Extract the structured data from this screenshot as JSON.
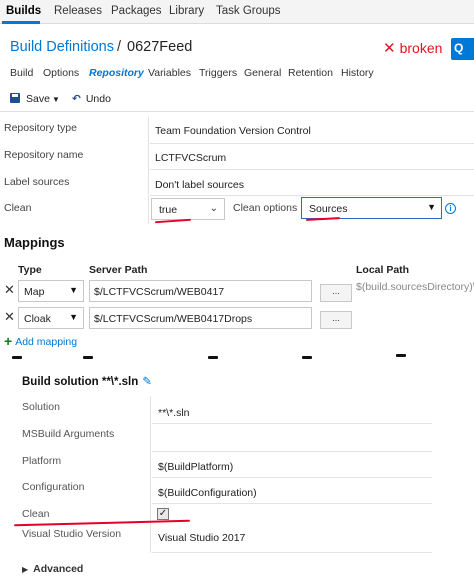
{
  "topnav": {
    "items": [
      "Builds",
      "Releases",
      "Packages",
      "Library",
      "Task Groups"
    ],
    "active": "Builds"
  },
  "header": {
    "breadcrumb": "Build Definitions",
    "separator": "/",
    "definition_name": "0627Feed",
    "status": "broken",
    "queue_button_text": "Q"
  },
  "tabs": {
    "items": [
      "Build",
      "Options",
      "Repository",
      "Variables",
      "Triggers",
      "General",
      "Retention",
      "History"
    ],
    "active": "Repository"
  },
  "toolbar": {
    "save_label": "Save",
    "undo_label": "Undo"
  },
  "repository": {
    "type_label": "Repository type",
    "type_value": "Team Foundation Version Control",
    "name_label": "Repository name",
    "name_value": "LCTFVCScrum",
    "label_sources_label": "Label sources",
    "label_sources_value": "Don't label sources",
    "clean_label": "Clean",
    "clean_value": "true",
    "clean_options_label": "Clean options",
    "clean_options_value": "Sources"
  },
  "mappings": {
    "title": "Mappings",
    "headers": {
      "type": "Type",
      "server_path": "Server Path",
      "local_path": "Local Path"
    },
    "rows": [
      {
        "type": "Map",
        "server_path": "$/LCTFVCScrum/WEB0417",
        "local_path": "$(build.sourcesDirectory)\\"
      },
      {
        "type": "Cloak",
        "server_path": "$/LCTFVCScrum/WEB0417Drops",
        "local_path": ""
      }
    ],
    "browse_label": "...",
    "add_label": "Add mapping"
  },
  "task": {
    "title": "Build solution **\\*.sln",
    "fields": {
      "solution_label": "Solution",
      "solution_value": "**\\*.sln",
      "msbuild_label": "MSBuild Arguments",
      "msbuild_value": "",
      "platform_label": "Platform",
      "platform_value": "$(BuildPlatform)",
      "configuration_label": "Configuration",
      "configuration_value": "$(BuildConfiguration)",
      "clean_label": "Clean",
      "vs_version_label": "Visual Studio Version",
      "vs_version_value": "Visual Studio 2017"
    },
    "advanced_label": "Advanced"
  },
  "colors": {
    "accent": "#0078d7",
    "error": "#e81123",
    "annotation": "#e4002b"
  }
}
